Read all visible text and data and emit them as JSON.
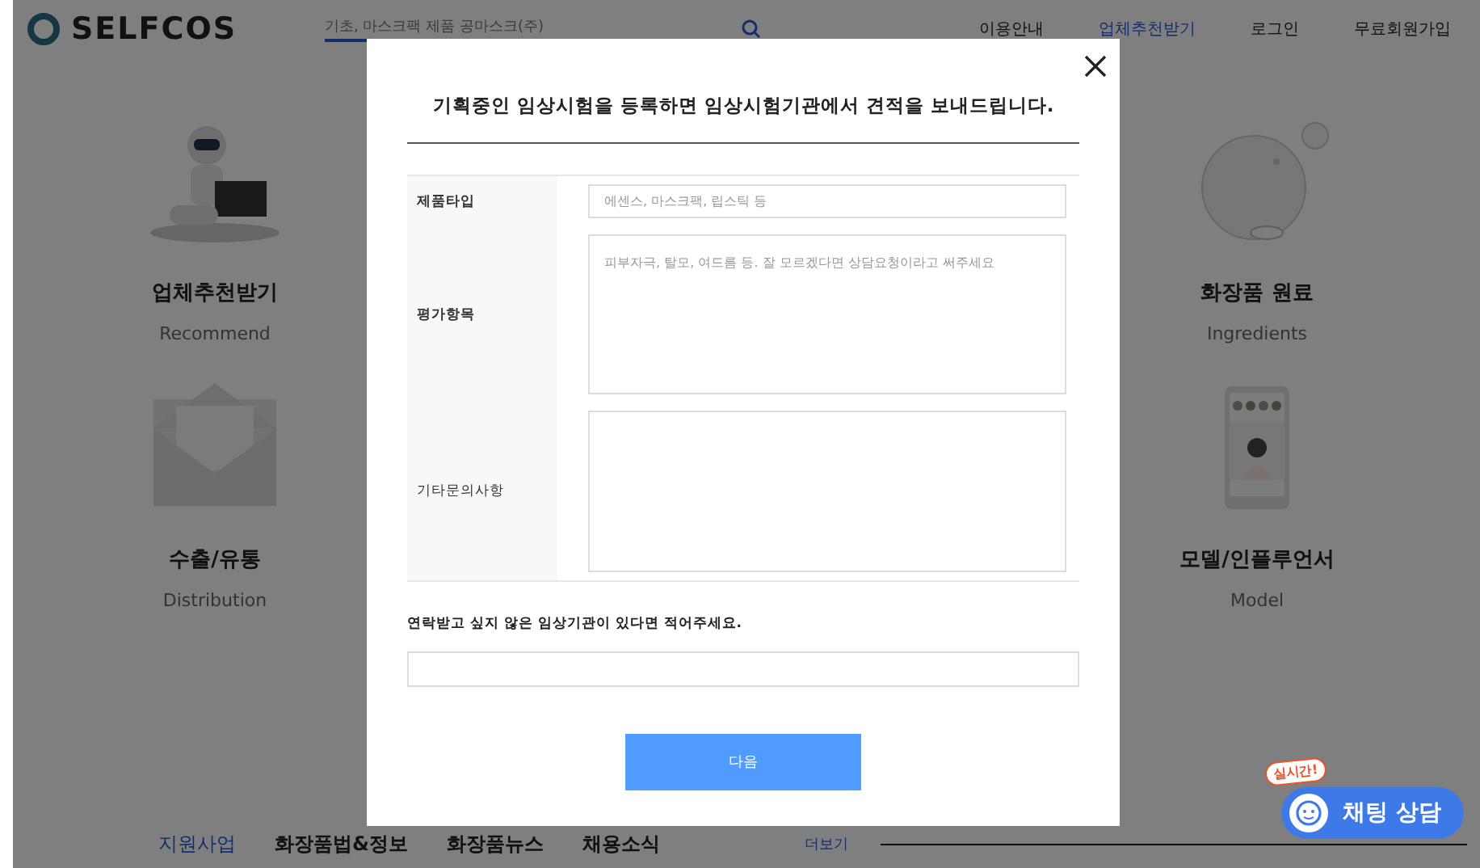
{
  "header": {
    "logo": "SELFCOS",
    "search": {
      "placeholder": "기초, 마스크팩 제품 공마스크(주)"
    },
    "nav": [
      {
        "label": "이용안내",
        "selected": false
      },
      {
        "label": "업체추천받기",
        "selected": true
      },
      {
        "label": "로그인",
        "selected": false
      },
      {
        "label": "무료회원가입",
        "selected": false
      }
    ]
  },
  "services": [
    {
      "title": "업체추천받기",
      "subtitle": "Recommend",
      "kind": "picture"
    },
    {
      "title": "화장품 원료",
      "subtitle": "Ingredients",
      "kind": "picture"
    },
    {
      "title": "수출/유통",
      "subtitle": "Distribution",
      "kind": "picture"
    },
    {
      "title": "모델/인플루언서",
      "subtitle": "Model",
      "kind": "picture"
    }
  ],
  "bottom_tabs": [
    {
      "label": "지원사업",
      "selected": true
    },
    {
      "label": "화장품법&정보",
      "selected": false
    },
    {
      "label": "화장품뉴스",
      "selected": false
    },
    {
      "label": "채용소식",
      "selected": false
    }
  ],
  "more_link": "더보기",
  "chat": {
    "badge": "실시간!",
    "label": "채팅 상담"
  },
  "modal": {
    "title": "기획중인 임상시험을 등록하면 임상시험기관에서 견적을 보내드립니다.",
    "fields": [
      {
        "label": "제품타입",
        "placeholder": "에센스, 마스크팩, 립스틱 등",
        "kind": "input",
        "emphasis": true
      },
      {
        "label": "평가항목",
        "placeholder": "피부자극, 탈모, 여드름 등. 잘 모르겠다면 상담요청이라고 써주세요",
        "kind": "textarea",
        "emphasis": true
      },
      {
        "label": "기타문의사항",
        "kind": "textarea",
        "emphasis": false
      }
    ],
    "exclude_label": "연락받고 싶지 않은 임상기관이 있다면 적어주세요.",
    "submit": "다음"
  }
}
